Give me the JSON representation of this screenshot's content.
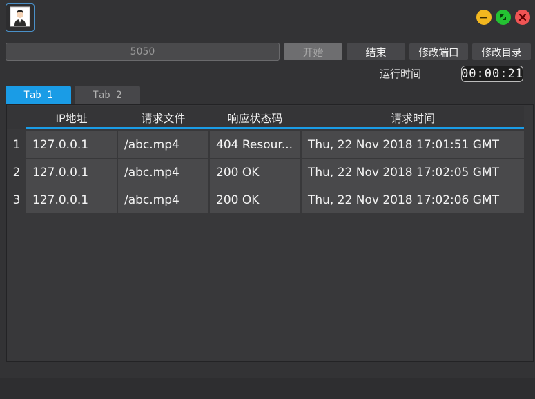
{
  "window": {
    "controls": {
      "minimize_icon": "minimize-icon",
      "maximize_icon": "maximize-icon",
      "close_icon": "close-icon"
    },
    "avatar_icon": "user-avatar-icon"
  },
  "toolbar": {
    "port_value": "5050",
    "start_label": "开始",
    "stop_label": "结束",
    "change_port_label": "修改端口",
    "change_dir_label": "修改目录",
    "runtime_label": "运行时间",
    "runtime_value": "00:00:21"
  },
  "tabs": [
    {
      "label": "Tab 1",
      "active": true
    },
    {
      "label": "Tab 2",
      "active": false
    }
  ],
  "table": {
    "columns": [
      "IP地址",
      "请求文件",
      "响应状态码",
      "请求时间"
    ],
    "rows": [
      {
        "num": "1",
        "ip": "127.0.0.1",
        "file": "/abc.mp4",
        "status": "404 Resour...",
        "time": "Thu, 22 Nov 2018 17:01:51 GMT"
      },
      {
        "num": "2",
        "ip": "127.0.0.1",
        "file": "/abc.mp4",
        "status": "200 OK",
        "time": "Thu, 22 Nov 2018 17:02:05 GMT"
      },
      {
        "num": "3",
        "ip": "127.0.0.1",
        "file": "/abc.mp4",
        "status": "200 OK",
        "time": "Thu, 22 Nov 2018 17:02:06 GMT"
      }
    ]
  },
  "colors": {
    "accent": "#1a9ce6",
    "background": "#333335",
    "minimize": "#f2b71f",
    "maximize": "#24c132",
    "close": "#f05454"
  }
}
